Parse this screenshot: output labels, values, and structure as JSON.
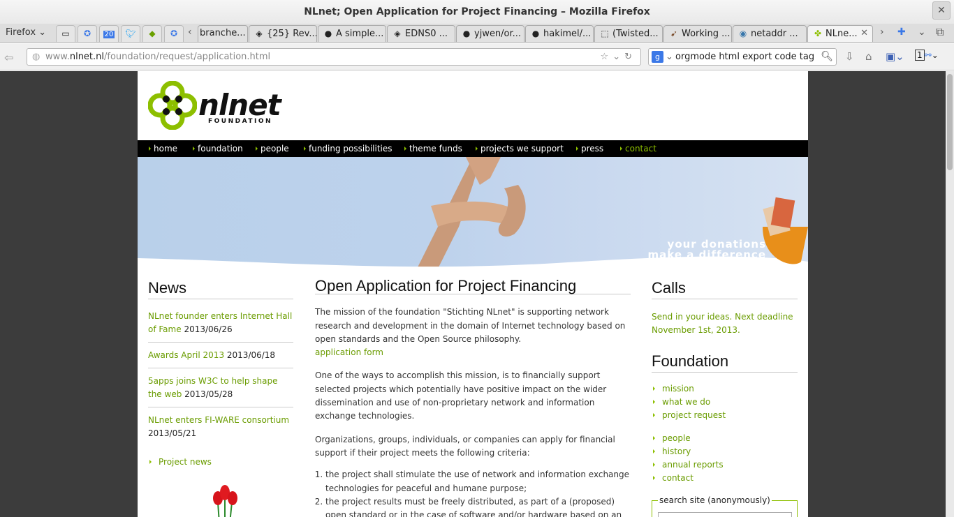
{
  "window": {
    "title": "NLnet; Open Application for Project Financing – Mozilla Firefox"
  },
  "browser": {
    "menu_label": "Firefox",
    "tabs": [
      {
        "icon": "puzzle-icon",
        "label": "branche..."
      },
      {
        "icon": "diamond-icon",
        "label": "{25} Rev..."
      },
      {
        "icon": "github-icon",
        "label": "A simple..."
      },
      {
        "icon": "diamond-icon",
        "label": "EDNS0 ..."
      },
      {
        "icon": "github-icon",
        "label": "yjwen/or..."
      },
      {
        "icon": "github-icon",
        "label": "hakimel/..."
      },
      {
        "icon": "blank-page-icon",
        "label": "(Twisted..."
      },
      {
        "icon": "bird-icon",
        "label": "Working ..."
      },
      {
        "icon": "python-icon",
        "label": "netaddr ..."
      },
      {
        "icon": "nlnet-icon",
        "label": "NLne..."
      }
    ],
    "pinned_badge": "20",
    "url": {
      "prefix": "www.",
      "domain": "nlnet.nl",
      "path": "/foundation/request/application.html"
    },
    "search": {
      "engine": "g",
      "query": "orgmode html export code tag"
    },
    "zoom_box": "1"
  },
  "site": {
    "logo": {
      "word_a": "nl",
      "word_b": "net",
      "sub": "FOUNDATION"
    },
    "nav": [
      "home",
      "foundation",
      "people",
      "funding possibilities",
      "theme funds",
      "projects we support",
      "press",
      "contact"
    ],
    "banner": {
      "line1": "your donations",
      "line2": "make a difference"
    },
    "news": {
      "heading": "News",
      "items": [
        {
          "title": "NLnet founder enters Internet Hall of Fame",
          "date": "2013/06/26"
        },
        {
          "title": "Awards April 2013",
          "date": "2013/06/18"
        },
        {
          "title": "5apps joins W3C to help shape the web",
          "date": "2013/05/28"
        },
        {
          "title": "NLnet enters FI-WARE consortium",
          "date": "2013/05/21"
        }
      ],
      "more": "Project news"
    },
    "main": {
      "heading": "Open Application for Project Financing",
      "p1": "The mission of the foundation \"Stichting NLnet\" is supporting network research and development in the domain of Internet technology based on open standards and the Open Source philosophy.",
      "p1_link": "application form",
      "p2": "One of the ways to accomplish this mission, is to financially support selected projects which potentially have positive impact on the wider dissemination and use of non-proprietary network and information exchange technologies.",
      "p3": "Organizations, groups, individuals, or companies can apply for financial support if their project meets the following criteria:",
      "criteria": [
        "the project shall stimulate the use of network and information exchange technologies for peaceful and humane purpose;",
        "the project results must be freely distributed, as part of a (proposed) open standard or in the case of software and/or hardware based on an adequate"
      ]
    },
    "calls": {
      "heading": "Calls",
      "text": "Send in your ideas. Next deadline November 1st, 2013."
    },
    "foundation": {
      "heading": "Foundation",
      "group1": [
        "mission",
        "what we do",
        "project request"
      ],
      "group2": [
        "people",
        "history",
        "annual reports",
        "contact"
      ]
    },
    "search_legend": "search site (anonymously)"
  }
}
